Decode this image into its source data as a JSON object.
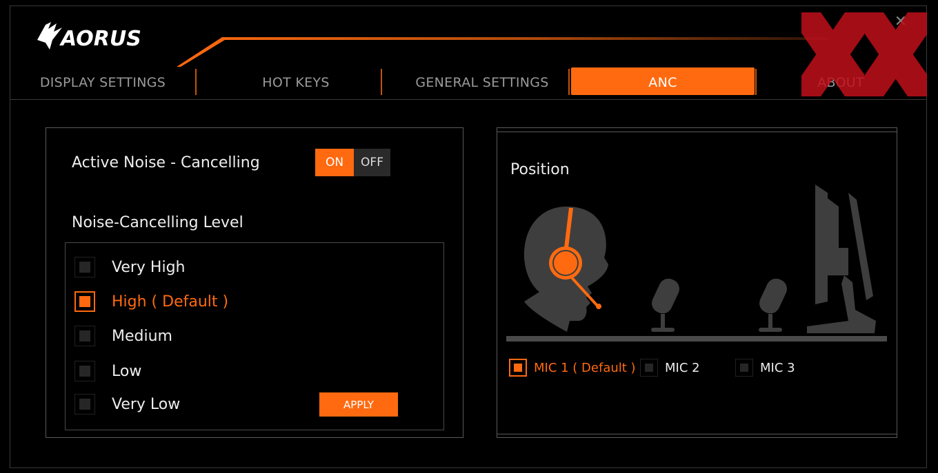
{
  "brand": {
    "logo_text": "AORUS"
  },
  "colors": {
    "accent": "#ff6a10",
    "background": "#000000"
  },
  "icons": {
    "close": "close-icon",
    "logo": "aorus-eagle-logo"
  },
  "tabs": [
    {
      "label": "DISPLAY SETTINGS",
      "active": false
    },
    {
      "label": "HOT KEYS",
      "active": false
    },
    {
      "label": "GENERAL SETTINGS",
      "active": false
    },
    {
      "label": "ANC",
      "active": true
    },
    {
      "label": "ABOUT",
      "active": false
    }
  ],
  "anc": {
    "title": "Active Noise - Cancelling",
    "toggle": {
      "on_label": "ON",
      "off_label": "OFF",
      "state": "ON"
    },
    "level_title": "Noise-Cancelling Level",
    "levels": [
      {
        "label": "Very High",
        "selected": false
      },
      {
        "label": "High ( Default )",
        "selected": true
      },
      {
        "label": "Medium",
        "selected": false
      },
      {
        "label": "Low",
        "selected": false
      },
      {
        "label": "Very Low",
        "selected": false
      }
    ],
    "apply_label": "APPLY"
  },
  "position": {
    "title": "Position",
    "mics": [
      {
        "label": "MIC 1 ( Default )",
        "selected": true
      },
      {
        "label": "MIC 2",
        "selected": false
      },
      {
        "label": "MIC 3",
        "selected": false
      }
    ]
  }
}
